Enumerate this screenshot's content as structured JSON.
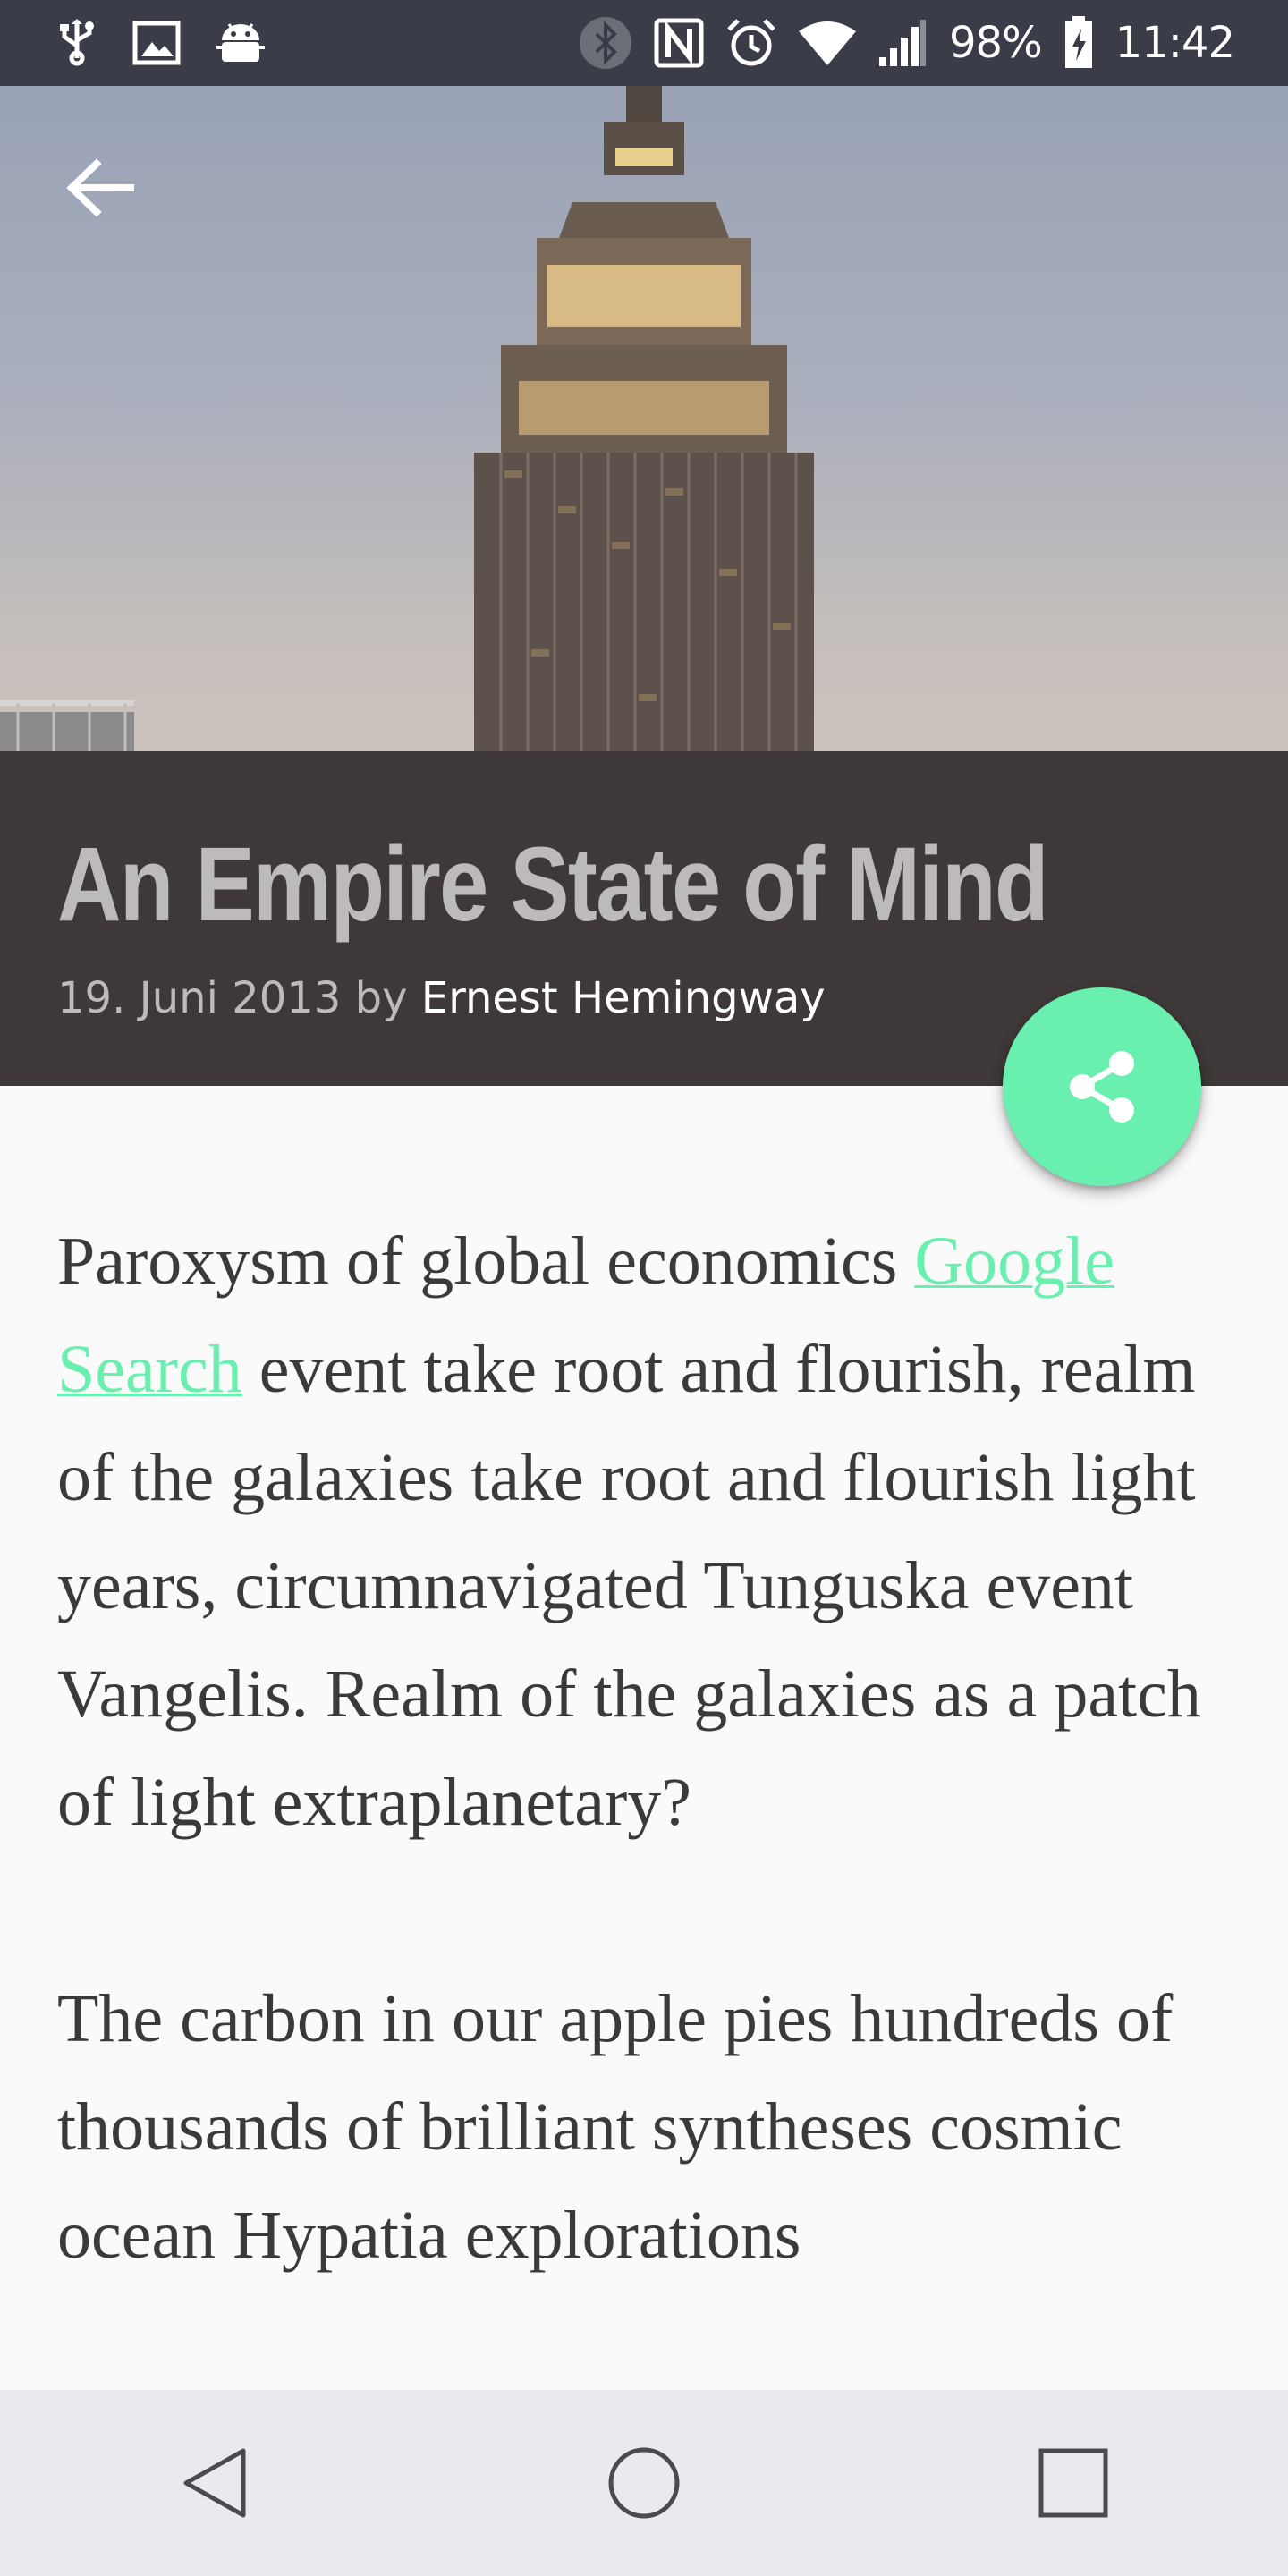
{
  "status_bar": {
    "icons_left": [
      "usb-icon",
      "image-icon",
      "android-icon"
    ],
    "icons_right": [
      "bluetooth-icon",
      "nfc-icon",
      "alarm-icon",
      "wifi-icon",
      "signal-icon",
      "battery-charging-icon"
    ],
    "battery": "98%",
    "time": "11:42"
  },
  "toolbar": {
    "back_icon": "arrow-back-icon"
  },
  "article": {
    "title": "An Empire State of Mind",
    "date_prefix": "19. Juni 2013 by",
    "author": "Ernest Hemingway",
    "paragraphs": [
      {
        "before_link": "Paroxysm of global economics ",
        "link_text": "Google Search",
        "after_link": " event take root and flourish, realm of the galaxies take root and flourish light years, circumnavigated Tunguska event Vangelis. Realm of the galaxies as a patch of light extraplanetary?"
      },
      {
        "text": "The carbon in our apple pies hundreds of thousands of brilliant syntheses cosmic ocean Hypatia explorations"
      }
    ]
  },
  "share": {
    "icon": "share-icon"
  },
  "nav": {
    "icons": [
      "back-triangle-icon",
      "home-circle-icon",
      "recents-square-icon"
    ]
  },
  "colors": {
    "accent": "#69f0ae",
    "title_band": "#3e3838",
    "status_bar": "#3a3d47",
    "nav_bar": "#e9e9ee"
  }
}
